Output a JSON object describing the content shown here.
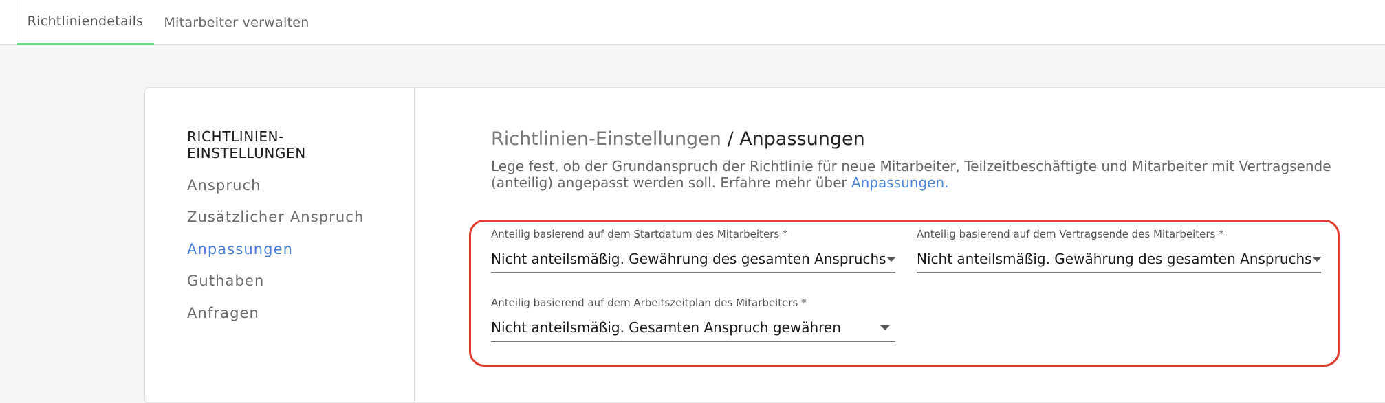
{
  "tabs": [
    {
      "label": "Richtliniendetails"
    },
    {
      "label": "Mitarbeiter verwalten"
    }
  ],
  "sidebar": {
    "heading_line1": "RICHTLINIEN-",
    "heading_line2": "EINSTELLUNGEN",
    "items": [
      {
        "label": "Anspruch"
      },
      {
        "label": "Zusätzlicher Anspruch"
      },
      {
        "label": "Anpassungen"
      },
      {
        "label": "Guthaben"
      },
      {
        "label": "Anfragen"
      }
    ]
  },
  "main": {
    "breadcrumb": "Richtlinien-Einstellungen",
    "separator": " / ",
    "title": "Anpassungen",
    "description": "Lege fest, ob der Grundanspruch der Richtlinie für neue Mitarbeiter, Teilzeitbeschäftigte und Mitarbeiter mit Vertragsende (anteilig) angepasst werden soll. Erfahre mehr über ",
    "learn_more_link": "Anpassungen."
  },
  "fields": [
    {
      "label": "Anteilig basierend auf dem Startdatum des Mitarbeiters *",
      "value": "Nicht anteilsmäßig. Gewährung des gesamten Anspruchs"
    },
    {
      "label": "Anteilig basierend auf dem Vertragsende des Mitarbeiters *",
      "value": "Nicht anteilsmäßig. Gewährung des gesamten Anspruchs"
    },
    {
      "label": "Anteilig basierend auf dem Arbeitszeitplan des Mitarbeiters *",
      "value": "Nicht anteilsmäßig. Gesamten Anspruch gewähren"
    }
  ],
  "colors": {
    "active_tab_underline": "#78d38a",
    "active_link": "#4a7fd6",
    "highlight_border": "#e03c2e"
  }
}
